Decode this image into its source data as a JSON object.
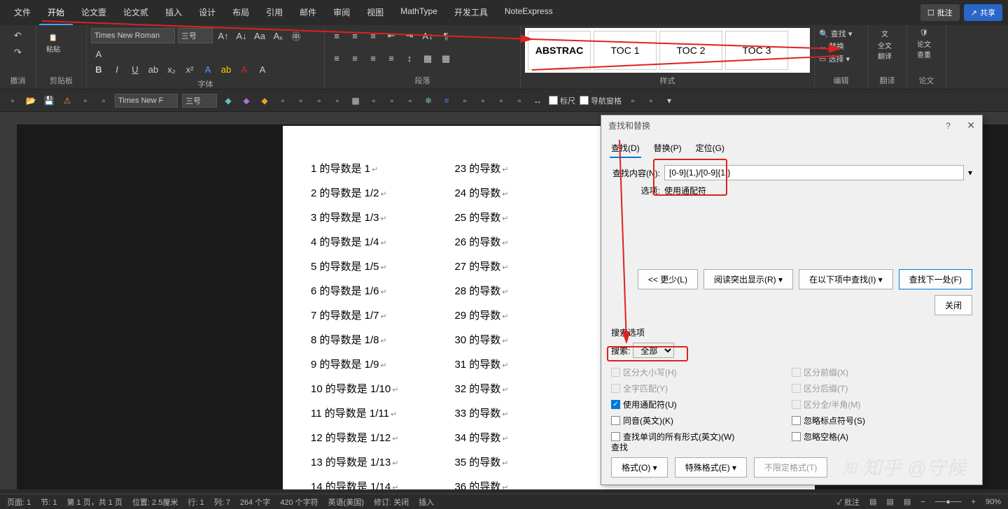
{
  "menu": [
    "文件",
    "开始",
    "论文壹",
    "论文贰",
    "插入",
    "设计",
    "布局",
    "引用",
    "邮件",
    "审阅",
    "视图",
    "MathType",
    "开发工具",
    "NoteExpress"
  ],
  "menu_active": 1,
  "title_buttons": {
    "annotate": "批注",
    "share": "共享"
  },
  "ribbon": {
    "groups": {
      "undo": "撤消",
      "clipboard": "剪贴板",
      "font": "字体",
      "paragraph": "段落",
      "styles": "样式",
      "editing": "编辑",
      "translate": "翻译",
      "thesis": "论文"
    },
    "paste": "粘贴",
    "font_name": "Times New Roman",
    "font_size": "三号",
    "styles_items": [
      "ABSTRAC",
      "TOC 1",
      "TOC 2",
      "TOC 3"
    ],
    "find": "查找",
    "replace": "替换",
    "select": "选择",
    "translate_full": "全文\n翻译",
    "thesis_check": "论文\n查重"
  },
  "qat": {
    "font_name": "Times New F",
    "font_size": "三号",
    "ruler": "标尺",
    "navpane": "导航窗格"
  },
  "document": {
    "left": [
      "1 的导数是 1",
      "2 的导数是 1/2",
      "3 的导数是 1/3",
      "4 的导数是 1/4",
      "5 的导数是 1/5",
      "6 的导数是 1/6",
      "7 的导数是 1/7",
      "8 的导数是 1/8",
      "9 的导数是 1/9",
      "10 的导数是 1/10",
      "11 的导数是 1/11",
      "12 的导数是 1/12",
      "13 的导数是 1/13",
      "14 的导数是 1/14"
    ],
    "right": [
      "23 的导数",
      "24 的导数",
      "25 的导数",
      "26 的导数",
      "27 的导数",
      "28 的导数",
      "29 的导数",
      "30 的导数",
      "31 的导数",
      "32 的导数",
      "33 的导数",
      "34 的导数",
      "35 的导数",
      "36 的导数"
    ]
  },
  "dialog": {
    "title": "查找和替换",
    "tabs": {
      "find": "查找(D)",
      "replace": "替换(P)",
      "goto": "定位(G)"
    },
    "find_label": "查找内容(N):",
    "find_value": "[0-9]{1,}/[0-9]{1,}",
    "options_label": "选项:",
    "options_value": "使用通配符",
    "buttons": {
      "less": "<< 更少(L)",
      "highlight": "阅读突出显示(R)",
      "findin": "在以下项中查找(I)",
      "findnext": "查找下一处(F)",
      "close": "关闭"
    },
    "search_options_title": "搜索选项",
    "search_dir_label": "搜索:",
    "search_dir_value": "全部",
    "opts_left": [
      {
        "label": "区分大小写(H)",
        "checked": false,
        "disabled": true
      },
      {
        "label": "全字匹配(Y)",
        "checked": false,
        "disabled": true
      },
      {
        "label": "使用通配符(U)",
        "checked": true,
        "disabled": false
      },
      {
        "label": "同音(英文)(K)",
        "checked": false,
        "disabled": false
      },
      {
        "label": "查找单词的所有形式(英文)(W)",
        "checked": false,
        "disabled": false
      }
    ],
    "opts_right": [
      {
        "label": "区分前缀(X)",
        "checked": false,
        "disabled": true
      },
      {
        "label": "区分后缀(T)",
        "checked": false,
        "disabled": true
      },
      {
        "label": "区分全/半角(M)",
        "checked": false,
        "disabled": true
      },
      {
        "label": "忽略标点符号(S)",
        "checked": false,
        "disabled": false
      },
      {
        "label": "忽略空格(A)",
        "checked": false,
        "disabled": false
      }
    ],
    "format_section": "查找",
    "format_btn": "格式(O)",
    "special_btn": "特殊格式(E)",
    "noformat_btn": "不限定格式(T)"
  },
  "statusbar": {
    "page": "页面: 1",
    "section": "节: 1",
    "pages": "第 1 页，共 1 页",
    "pos": "位置: 2.5厘米",
    "line": "行: 1",
    "col": "列: 7",
    "words": "264 个字",
    "chars": "420 个字符",
    "lang": "英语(美国)",
    "track": "修订: 关闭",
    "insert": "插入",
    "annotate": "批注",
    "zoom": "90%"
  },
  "watermark": "知乎 @守候"
}
